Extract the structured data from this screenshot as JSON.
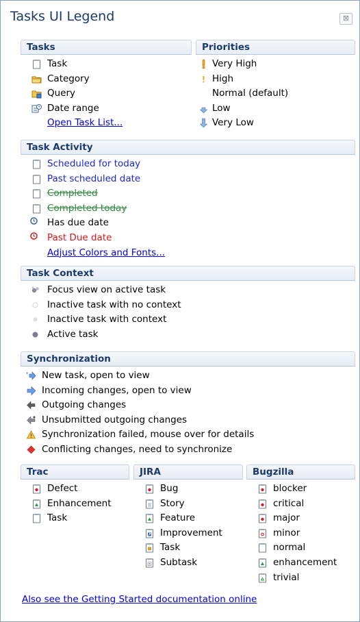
{
  "window": {
    "title": "Tasks UI Legend"
  },
  "tasks": {
    "header": "Tasks",
    "items": [
      {
        "icon": "task-icon",
        "label": "Task"
      },
      {
        "icon": "category-folder-icon",
        "label": "Category"
      },
      {
        "icon": "query-folder-icon",
        "label": "Query"
      },
      {
        "icon": "date-range-icon",
        "label": "Date range"
      }
    ],
    "link": "Open Task List..."
  },
  "priorities": {
    "header": "Priorities",
    "items": [
      {
        "icon": "very-high-priority-icon",
        "label": "Very High"
      },
      {
        "icon": "high-priority-icon",
        "label": "High"
      },
      {
        "icon": "",
        "label": "Normal (default)"
      },
      {
        "icon": "low-priority-icon",
        "label": "Low"
      },
      {
        "icon": "very-low-priority-icon",
        "label": "Very Low"
      }
    ]
  },
  "activity": {
    "header": "Task Activity",
    "items": [
      {
        "icon": "task-icon",
        "label": "Scheduled for today",
        "style": "blue"
      },
      {
        "icon": "task-icon",
        "label": "Past scheduled date",
        "style": "blue"
      },
      {
        "icon": "task-icon",
        "label": "Completed",
        "style": "strike"
      },
      {
        "icon": "task-icon",
        "label": "Completed today",
        "style": "strike"
      },
      {
        "icon": "due-date-clock-icon",
        "label": "Has due date",
        "style": ""
      },
      {
        "icon": "past-due-clock-icon",
        "label": "Past Due date",
        "style": "red"
      }
    ],
    "link": "Adjust Colors and Fonts..."
  },
  "context": {
    "header": "Task Context",
    "items": [
      {
        "icon": "focus-view-icon",
        "label": "Focus view on active task"
      },
      {
        "icon": "inactive-no-context-icon",
        "label": "Inactive task with no context"
      },
      {
        "icon": "inactive-context-icon",
        "label": "Inactive task with context"
      },
      {
        "icon": "active-task-icon",
        "label": "Active task"
      }
    ]
  },
  "sync": {
    "header": "Synchronization",
    "items": [
      {
        "icon": "new-task-icon",
        "label": "New task, open to view"
      },
      {
        "icon": "incoming-changes-icon",
        "label": "Incoming changes, open to view"
      },
      {
        "icon": "outgoing-changes-icon",
        "label": "Outgoing changes"
      },
      {
        "icon": "unsubmitted-changes-icon",
        "label": "Unsubmitted outgoing changes"
      },
      {
        "icon": "sync-failed-warning-icon",
        "label": "Synchronization failed, mouse over for details"
      },
      {
        "icon": "conflict-icon",
        "label": "Conflicting changes, need to synchronize"
      }
    ]
  },
  "trac": {
    "header": "Trac",
    "items": [
      {
        "icon": "defect-icon",
        "label": "Defect"
      },
      {
        "icon": "enhancement-icon",
        "label": "Enhancement"
      },
      {
        "icon": "task-icon",
        "label": "Task"
      }
    ]
  },
  "jira": {
    "header": "JIRA",
    "items": [
      {
        "icon": "bug-icon",
        "label": "Bug"
      },
      {
        "icon": "story-icon",
        "label": "Story"
      },
      {
        "icon": "feature-icon",
        "label": "Feature"
      },
      {
        "icon": "improvement-icon",
        "label": "Improvement"
      },
      {
        "icon": "jira-task-icon",
        "label": "Task"
      },
      {
        "icon": "subtask-icon",
        "label": "Subtask"
      }
    ]
  },
  "bugzilla": {
    "header": "Bugzilla",
    "items": [
      {
        "icon": "blocker-icon",
        "label": "blocker"
      },
      {
        "icon": "critical-icon",
        "label": "critical"
      },
      {
        "icon": "major-icon",
        "label": "major"
      },
      {
        "icon": "minor-icon",
        "label": "minor"
      },
      {
        "icon": "normal-icon",
        "label": "normal"
      },
      {
        "icon": "enhancement-icon",
        "label": "enhancement"
      },
      {
        "icon": "trivial-icon",
        "label": "trivial"
      }
    ]
  },
  "footer": {
    "link": "Also see the Getting Started documentation online"
  }
}
